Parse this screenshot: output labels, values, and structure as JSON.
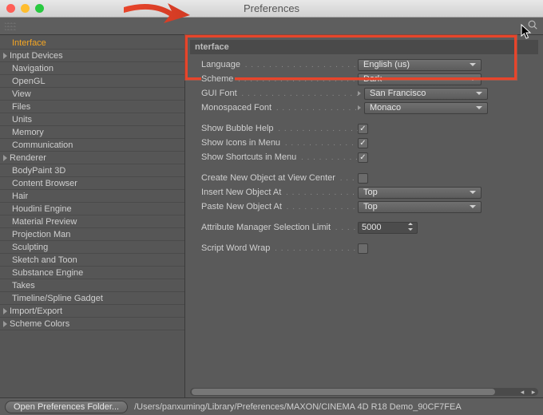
{
  "window": {
    "title": "Preferences"
  },
  "sidebar": {
    "items": [
      {
        "label": "Interface",
        "expandable": false,
        "active": true
      },
      {
        "label": "Input Devices",
        "expandable": true
      },
      {
        "label": "Navigation",
        "expandable": false
      },
      {
        "label": "OpenGL",
        "expandable": false
      },
      {
        "label": "View",
        "expandable": false
      },
      {
        "label": "Files",
        "expandable": false
      },
      {
        "label": "Units",
        "expandable": false
      },
      {
        "label": "Memory",
        "expandable": false
      },
      {
        "label": "Communication",
        "expandable": false
      },
      {
        "label": "Renderer",
        "expandable": true
      },
      {
        "label": "BodyPaint 3D",
        "expandable": false
      },
      {
        "label": "Content Browser",
        "expandable": false
      },
      {
        "label": "Hair",
        "expandable": false
      },
      {
        "label": "Houdini Engine",
        "expandable": false
      },
      {
        "label": "Material Preview",
        "expandable": false
      },
      {
        "label": "Projection Man",
        "expandable": false
      },
      {
        "label": "Sculpting",
        "expandable": false
      },
      {
        "label": "Sketch and Toon",
        "expandable": false
      },
      {
        "label": "Substance Engine",
        "expandable": false
      },
      {
        "label": "Takes",
        "expandable": false
      },
      {
        "label": "Timeline/Spline Gadget",
        "expandable": false
      },
      {
        "label": "Import/Export",
        "expandable": true
      },
      {
        "label": "Scheme Colors",
        "expandable": true
      }
    ]
  },
  "panel": {
    "header": "nterface",
    "language": {
      "label": "Language",
      "value": "English (us)"
    },
    "scheme": {
      "label": "Scheme",
      "value": "Dark"
    },
    "gui_font": {
      "label": "GUI Font",
      "value": "San Francisco",
      "has_chevron": true
    },
    "mono_font": {
      "label": "Monospaced Font",
      "value": "Monaco",
      "has_chevron": true
    },
    "show_bubble_help": {
      "label": "Show Bubble Help",
      "checked": true
    },
    "show_icons_in_menu": {
      "label": "Show Icons in Menu",
      "checked": true
    },
    "show_shortcuts_in_menu": {
      "label": "Show Shortcuts in Menu",
      "checked": true
    },
    "create_new_obj_center": {
      "label": "Create New Object at View Center",
      "checked": false
    },
    "insert_new_obj": {
      "label": "Insert New Object At",
      "value": "Top"
    },
    "paste_new_obj": {
      "label": "Paste New Object At",
      "value": "Top"
    },
    "attr_selection_limit": {
      "label": "Attribute Manager Selection Limit",
      "value": "5000"
    },
    "script_word_wrap": {
      "label": "Script Word Wrap",
      "checked": false
    }
  },
  "footer": {
    "button": "Open Preferences Folder...",
    "path": "/Users/panxuming/Library/Preferences/MAXON/CINEMA 4D R18 Demo_90CF7FEA"
  }
}
